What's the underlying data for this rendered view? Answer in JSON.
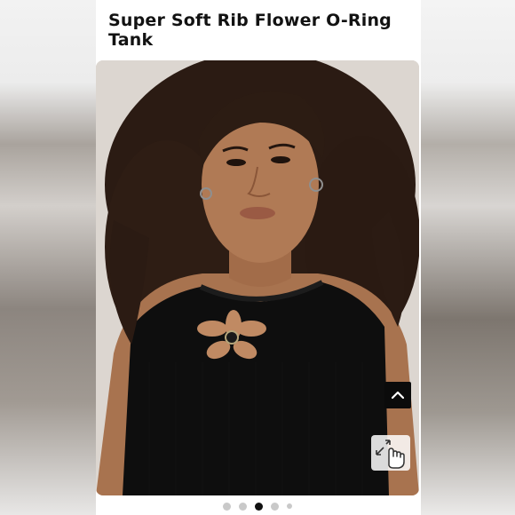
{
  "product": {
    "title": "Super Soft Rib Flower O-Ring Tank"
  },
  "carousel": {
    "slide_count": 5,
    "active_index": 2
  },
  "controls": {
    "scroll_top_icon": "chevron-up-icon",
    "zoom_icon": "tap-to-zoom-icon"
  },
  "colors": {
    "title": "#121212",
    "garment": "#0e0e0e",
    "dot_active": "#111111",
    "dot_inactive": "#c9c9c9"
  }
}
